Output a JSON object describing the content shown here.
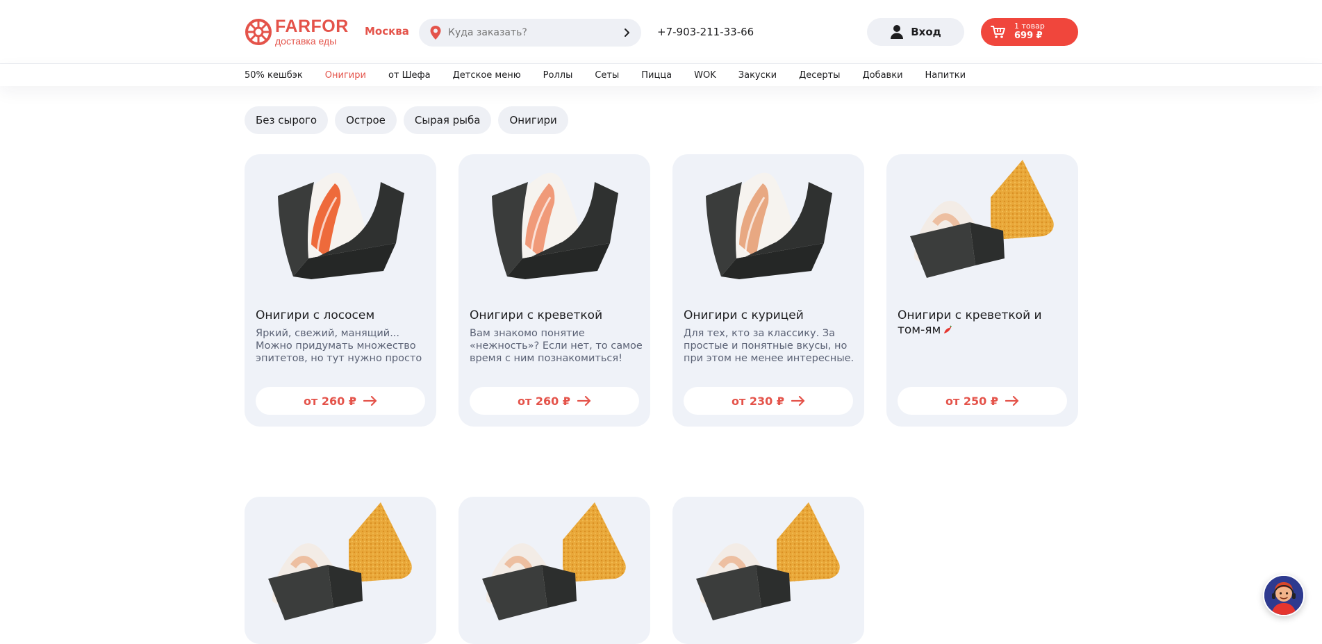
{
  "header": {
    "logo_word": "FARFOR",
    "logo_sub": "доставка еды",
    "city": "Москва",
    "search_placeholder": "Куда заказать?",
    "phone": "+7-903-211-33-66",
    "login_label": "Вход",
    "cart_count": "1 товар",
    "cart_sum": "699 ₽"
  },
  "nav": [
    "50% кешбэк",
    "Онигири",
    "от Шефа",
    "Детское меню",
    "Роллы",
    "Сеты",
    "Пицца",
    "WOK",
    "Закуски",
    "Десерты",
    "Добавки",
    "Напитки"
  ],
  "nav_active": "Онигири",
  "filters": [
    "Без сырого",
    "Острое",
    "Сырая рыба",
    "Онигири"
  ],
  "products": [
    {
      "title": "Онигири с лососем",
      "desc": "Яркий, свежий, манящий... Можно придумать множество эпитетов, но тут нужно просто попробовать!",
      "price": "от 260 ₽",
      "filling": "salmon"
    },
    {
      "title": "Онигири с креветкой",
      "desc": "Вам знакомо понятие «нежность»? Если нет, то самое время с ним познакомиться!",
      "price": "от 260 ₽",
      "filling": "shrimp"
    },
    {
      "title": "Онигири с курицей",
      "desc": "Для тех, кто за классику. За простые и понятные вкусы, но при этом не менее интересные. Это вкусно!",
      "price": "от 230 ₽",
      "filling": "chicken"
    },
    {
      "title": "Онигири с креветкой и том-ям",
      "desc": "",
      "price": "от 250 ₽",
      "filling": "fried",
      "spicy": true
    },
    {
      "title": "",
      "desc": "",
      "price": "",
      "filling": "fried"
    },
    {
      "title": "",
      "desc": "",
      "price": "",
      "filling": "fried"
    },
    {
      "title": "",
      "desc": "",
      "price": "",
      "filling": "fried"
    }
  ],
  "colors": {
    "brand": "#e4534a",
    "cart": "#f0463c",
    "card_bg": "#eff2f8",
    "chip_bg": "#eef0f5"
  },
  "icons": [
    "logo-mark-icon",
    "location-pin-icon",
    "chevron-right-icon",
    "user-icon",
    "cart-icon",
    "arrow-right-icon",
    "chili-icon",
    "chat-avatar-icon"
  ]
}
